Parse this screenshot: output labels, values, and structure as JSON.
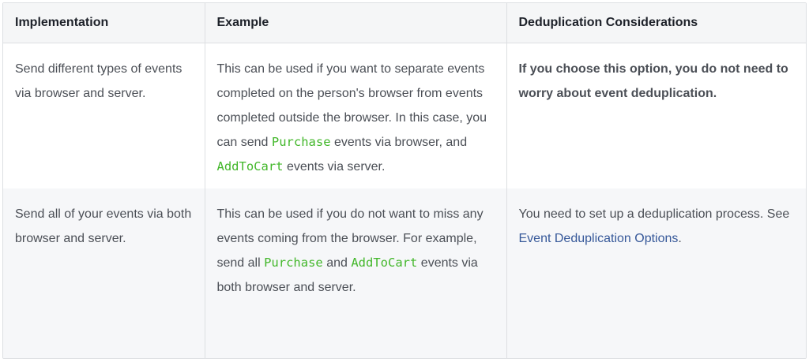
{
  "table": {
    "headers": {
      "implementation": "Implementation",
      "example": "Example",
      "dedup": "Deduplication Considerations"
    },
    "rows": [
      {
        "implementation": "Send different types of events via browser and server.",
        "example": {
          "part1": "This can be used if you want to separate events completed on the person's browser from events completed outside the browser. In this case, you can send ",
          "code1": "Purchase",
          "part2": " events via browser, and ",
          "code2": "AddToCart",
          "part3": " events via server."
        },
        "dedup": {
          "bold_text": "If you choose this option, you do not need to worry about event deduplication."
        }
      },
      {
        "implementation": "Send all of your events via both browser and server.",
        "example": {
          "part1": "This can be used if you do not want to miss any events coming from the browser. For example, send all ",
          "code1": "Purchase",
          "part2": " and ",
          "code2": "AddToCart",
          "part3": " events via both browser and server."
        },
        "dedup": {
          "text": "You need to set up a deduplication process. See ",
          "link_text": "Event Deduplication Options",
          "suffix": "."
        }
      }
    ]
  },
  "colors": {
    "code": "#42b72a",
    "link": "#365899",
    "header_bg": "#f5f6f7",
    "alt_row_bg": "#f6f7f9",
    "border": "#dddfe2"
  }
}
